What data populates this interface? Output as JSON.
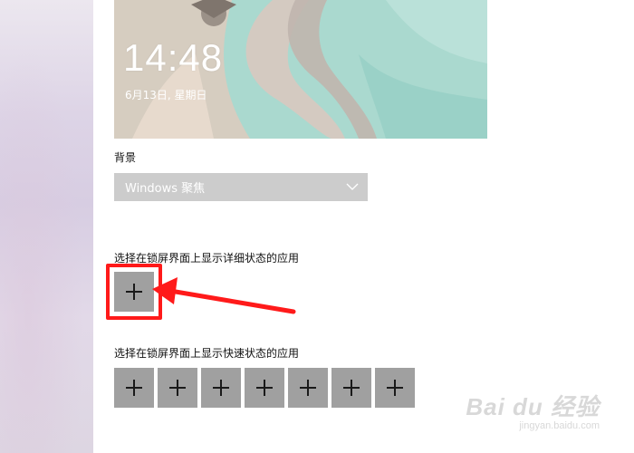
{
  "lock_preview": {
    "time": "14:48",
    "date": "6月13日, 星期日"
  },
  "background": {
    "label": "背景",
    "selected_value": "Windows 聚焦"
  },
  "detailed_status": {
    "label": "选择在锁屏界面上显示详细状态的应用",
    "tile_icon": "plus-icon"
  },
  "quick_status": {
    "label": "选择在锁屏界面上显示快速状态的应用",
    "tile_count": 7,
    "tile_icon": "plus-icon"
  },
  "annotation": {
    "highlight_color": "#ff1a1a",
    "arrow_color": "#ff1a1a"
  },
  "watermark": {
    "brand": "Bai du 经验",
    "url": "jingyan.baidu.com"
  }
}
